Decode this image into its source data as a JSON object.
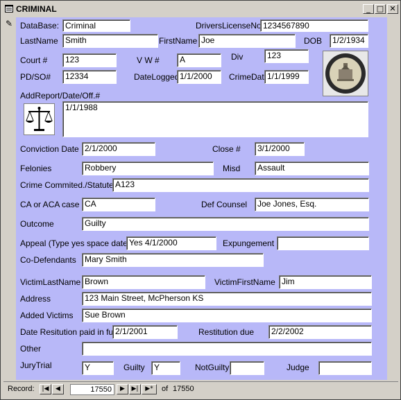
{
  "window": {
    "title": "CRIMINAL"
  },
  "labels": {
    "database": "DataBase:",
    "drivers_license": "DriversLicenseNo:",
    "lastname": "LastName",
    "firstname": "FirstName",
    "dob": "DOB",
    "court": "Court #",
    "vw": "V W #",
    "div": "Div",
    "pd_so": "PD/SO#",
    "date_logged": "DateLogged",
    "crime_date": "CrimeDate",
    "add_report": "AddReport/Date/Off.#",
    "conviction_date": "Conviction Date",
    "close": "Close #",
    "felonies": "Felonies",
    "misd": "Misd",
    "statute": "Crime Commited./Statute #",
    "ca_case": "CA or ACA case",
    "def_counsel": "Def Counsel",
    "outcome": "Outcome",
    "appeal": "Appeal (Type yes space date)",
    "expungement": "Expungement",
    "co_defendants": "Co-Defendants",
    "victim_last": "VictimLastName",
    "victim_first": "VictimFirstName",
    "address": "Address",
    "added_victims": "Added Victims",
    "restitution_paid": "Date Resitution paid in full",
    "restitution_due": "Restitution due",
    "other": "Other",
    "jury_trial": "JuryTrial",
    "guilty": "Guilty",
    "not_guilty": "NotGuilty",
    "judge": "Judge"
  },
  "values": {
    "database": "Criminal",
    "drivers_license": "1234567890",
    "lastname": "Smith",
    "firstname": "Joe",
    "dob": "1/2/1934",
    "court": "123",
    "vw": "A",
    "div": "123",
    "pd_so": "12334",
    "date_logged": "1/1/2000",
    "crime_date": "1/1/1999",
    "add_report": "1/1/1988",
    "conviction_date": "2/1/2000",
    "close": "3/1/2000",
    "felonies": "Robbery",
    "misd": "Assault",
    "statute": "A123",
    "ca_case": "CA",
    "def_counsel": "Joe Jones, Esq.",
    "outcome": "Guilty",
    "appeal": "Yes 4/1/2000",
    "expungement": "",
    "co_defendants": "Mary Smith",
    "victim_last": "Brown",
    "victim_first": "Jim",
    "address": "123 Main Street, McPherson KS",
    "added_victims": "Sue Brown",
    "restitution_paid": "2/1/2001",
    "restitution_due": "2/2/2002",
    "other": "",
    "jury_trial": "Y",
    "guilty": "Y",
    "not_guilty": "",
    "judge": ""
  },
  "seal": {
    "text_top": "McPHERSON COUNTY",
    "text_bottom": "KANSAS"
  },
  "navigation": {
    "record_label": "Record:",
    "current_record": "17550",
    "of_label": "of",
    "total_records": "17550"
  },
  "icons": {
    "app": "form-icon",
    "scales": "scales-of-justice-icon",
    "minimize": "minimize-icon",
    "maximize": "maximize-icon",
    "close": "close-icon"
  },
  "colors": {
    "form_background": "#b8b8f8",
    "chrome": "#d4d0c8"
  }
}
